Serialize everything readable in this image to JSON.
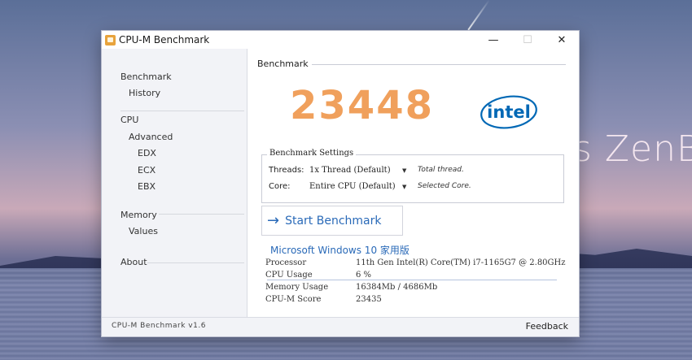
{
  "desktop": {
    "wallpaper_text": "s ZenBo"
  },
  "window": {
    "title": "CPU-M Benchmark",
    "controls": {
      "minimize": "—",
      "maximize": "☐",
      "close": "✕"
    }
  },
  "sidebar": {
    "items": [
      {
        "label": "Benchmark"
      },
      {
        "label": "History"
      },
      {
        "label": "CPU"
      },
      {
        "label": "Advanced"
      },
      {
        "label": "EDX"
      },
      {
        "label": "ECX"
      },
      {
        "label": "EBX"
      },
      {
        "label": "Memory"
      },
      {
        "label": "Values"
      },
      {
        "label": "About"
      }
    ]
  },
  "benchmark": {
    "section_title": "Benchmark",
    "score": "23448",
    "logo": "intel",
    "settings": {
      "legend": "Benchmark Settings",
      "threads": {
        "label": "Threads:",
        "value": "1x Thread (Default)",
        "note": "Total thread."
      },
      "core": {
        "label": "Core:",
        "value": "Entire CPU (Default)",
        "note": "Selected Core."
      }
    },
    "start_button": {
      "arrow": "→",
      "label": "Start Benchmark"
    }
  },
  "system": {
    "os_title": "Microsoft Windows 10 家用版",
    "rows": [
      {
        "key": "Processor",
        "value": "11th Gen Intel(R) Core(TM) i7-1165G7 @ 2.80GHz"
      },
      {
        "key": "CPU Usage",
        "value": "6 %"
      },
      {
        "key": "Memory Usage",
        "value": "16384Mb / 4686Mb"
      },
      {
        "key": "CPU-M Score",
        "value": "23435"
      }
    ]
  },
  "statusbar": {
    "version": "CPU-M Benchmark v1.6",
    "feedback": "Feedback"
  },
  "colors": {
    "accent": "#2a6ab8",
    "score": "#f0a05c",
    "intel_blue": "#0068b5"
  }
}
